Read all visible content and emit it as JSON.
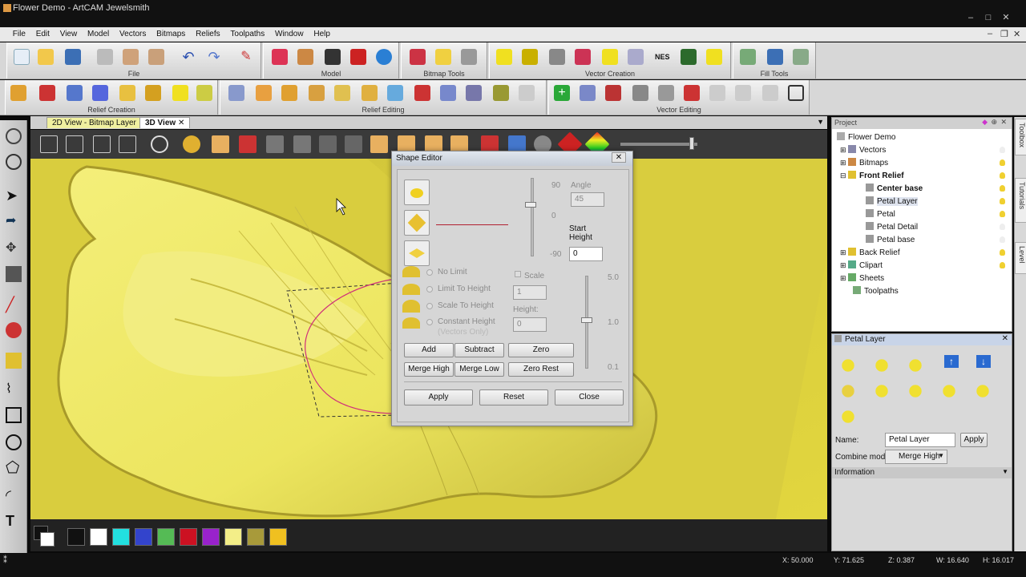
{
  "window": {
    "title": "Flower Demo - ArtCAM Jewelsmith",
    "controls": [
      "–",
      "□",
      "✕"
    ]
  },
  "menu": [
    "File",
    "Edit",
    "View",
    "Model",
    "Vectors",
    "Bitmaps",
    "Reliefs",
    "Toolpaths",
    "Window",
    "Help"
  ],
  "toolbar_groups": {
    "file": "File",
    "model": "Model",
    "bitmap_tools": "Bitmap Tools",
    "vector_creation": "Vector Creation",
    "fill_tools": "Fill Tools",
    "relief_creation": "Relief Creation",
    "relief_editing": "Relief Editing",
    "vector_editing": "Vector Editing"
  },
  "view_tabs": [
    {
      "label": "2D View - Bitmap Layer",
      "active": false
    },
    {
      "label": "3D View",
      "active": true
    }
  ],
  "shape_editor": {
    "title": "Shape Editor",
    "close_x": "✕",
    "angle_label": "Angle",
    "angle_value": "45",
    "slider_top": "90",
    "slider_mid": "0",
    "slider_bottom": "-90",
    "start_height_label": "Start Height",
    "start_height_value": "0",
    "options": [
      "No Limit",
      "Limit To Height",
      "Scale To Height",
      "Constant Height"
    ],
    "vectors_only": "(Vectors Only)",
    "scale_label": "Scale",
    "scale_value": "1",
    "height_label": "Height:",
    "height_value": "0",
    "scale_slider_top": "5.0",
    "scale_slider_mid": "1.0",
    "scale_slider_bottom": "0.1",
    "buttons_row1": [
      "Add",
      "Subtract",
      "Zero"
    ],
    "buttons_row2": [
      "Merge High",
      "Merge Low",
      "Zero Rest"
    ],
    "footer_buttons": [
      "Apply",
      "Reset",
      "Close"
    ]
  },
  "project": {
    "header": "Project",
    "nodes": [
      {
        "label": "Flower Demo",
        "level": 0,
        "bold": false
      },
      {
        "label": "Vectors",
        "level": 1,
        "bold": false
      },
      {
        "label": "Bitmaps",
        "level": 1,
        "bold": false
      },
      {
        "label": "Front Relief",
        "level": 1,
        "bold": true
      },
      {
        "label": "Center base",
        "level": 2,
        "bold": true
      },
      {
        "label": "Petal Layer",
        "level": 2,
        "bold": false,
        "selected": true
      },
      {
        "label": "Petal",
        "level": 2,
        "bold": false
      },
      {
        "label": "Petal Detail",
        "level": 2,
        "bold": false
      },
      {
        "label": "Petal base",
        "level": 2,
        "bold": false
      },
      {
        "label": "Back Relief",
        "level": 1,
        "bold": false
      },
      {
        "label": "Clipart",
        "level": 1,
        "bold": false
      },
      {
        "label": "Sheets",
        "level": 1,
        "bold": false
      },
      {
        "label": "Toolpaths",
        "level": 1,
        "bold": false
      }
    ]
  },
  "layer_panel": {
    "header": "Petal Layer",
    "name_label": "Name:",
    "name_value": "Petal Layer",
    "apply_label": "Apply",
    "combine_label": "Combine mode:",
    "combine_value": "Merge High",
    "information_label": "Information"
  },
  "side_tabs": [
    "Toolbox",
    "Tutorials",
    "Level"
  ],
  "status": {
    "x": "X: 50.000",
    "y": "Y: 71.625",
    "z": "Z: 0.387",
    "w": "W: 16.640",
    "h": "H: 16.017"
  },
  "palette_colors": [
    "#111111",
    "#ffffff",
    "#22e0e0",
    "#3344cc",
    "#55bb55",
    "#cc1122",
    "#9922cc",
    "#f3ee88",
    "#a89a3a",
    "#f0c020"
  ],
  "colors": {
    "relief_yellow": "#e8e060",
    "curve_pink": "#d0307a",
    "titlebar": "#111111"
  }
}
